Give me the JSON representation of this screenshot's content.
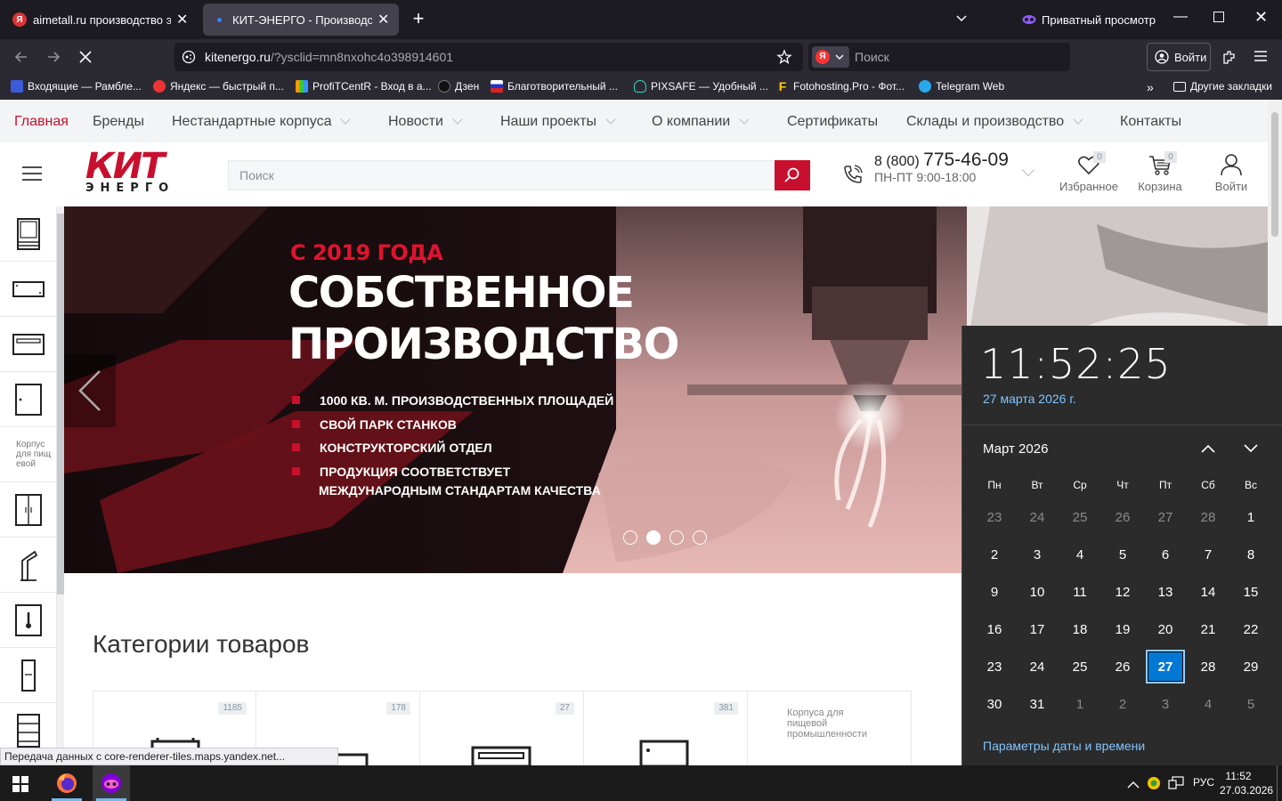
{
  "browser": {
    "tabs": [
      {
        "title": "aimetall.ru производство элект",
        "active": false
      },
      {
        "title": "КИТ-ЭНЕРГО - Производство э",
        "active": true
      }
    ],
    "private_label": "Приватный просмотр",
    "url_domain": "kitenergo.ru",
    "url_path": "/?ysclid=mn8nxohc4o398914601",
    "search_placeholder": "Поиск",
    "login_label": "Войти",
    "bookmarks": [
      "Входящие — Рамбле...",
      "Яндекс — быстрый п...",
      "ProfiTCentR - Вход в а...",
      "Дзен",
      "Благотворительный ...",
      "PIXSAFE — Удобный ...",
      "Fotohosting.Pro - Фот...",
      "Telegram Web"
    ],
    "other_bookmarks": "Другие закладки",
    "status_text": "Передача данных с core-renderer-tiles.maps.yandex.net..."
  },
  "site": {
    "topnav": [
      {
        "label": "Главная",
        "active": true,
        "chevron": false
      },
      {
        "label": "Бренды",
        "active": false,
        "chevron": false
      },
      {
        "label": "Нестандартные корпуса",
        "active": false,
        "chevron": true
      },
      {
        "label": "Новости",
        "active": false,
        "chevron": true
      },
      {
        "label": "Наши проекты",
        "active": false,
        "chevron": true
      },
      {
        "label": "О компании",
        "active": false,
        "chevron": true
      },
      {
        "label": "Сертификаты",
        "active": false,
        "chevron": false
      },
      {
        "label": "Склады и производство",
        "active": false,
        "chevron": true
      },
      {
        "label": "Контакты",
        "active": false,
        "chevron": false
      }
    ],
    "logo_top": "КИТ",
    "logo_bottom": "ЭНЕРГО",
    "search_placeholder": "Поиск",
    "phone_prefix": "8 (800) ",
    "phone_main": "775-46-09",
    "hours": "ПН-ПТ 9:00-18:00",
    "favorites_label": "Избранное",
    "favorites_count": "0",
    "cart_label": "Корзина",
    "cart_count": "0",
    "login_label": "Войти",
    "sidebar_text": "Корпус для пищевой",
    "banner": {
      "kicker": "С 2019 ГОДА",
      "title_line1": "СОБСТВЕННОЕ",
      "title_line2": "ПРОИЗВОДСТВО",
      "bullets": [
        "1000 КВ. М. ПРОИЗВОДСТВЕННЫХ ПЛОЩАДЕЙ",
        "СВОЙ ПАРК СТАНКОВ",
        "КОНСТРУКТОРСКИЙ ОТДЕЛ",
        "ПРОДУКЦИЯ СООТВЕТСТВУЕТ"
      ],
      "bullet_cont": "МЕЖДУНАРОДНЫМ СТАНДАРТАМ КАЧЕСТВА",
      "active_dot": 2
    },
    "categories_title": "Категории товаров",
    "category_counts": [
      "1185",
      "178",
      "27",
      "381"
    ],
    "category_text": "Корпуса для пищевой промышленности"
  },
  "calendar": {
    "time": "11:52:25",
    "date_long": "27 марта 2026 г.",
    "month": "Март 2026",
    "weekdays": [
      "Пн",
      "Вт",
      "Ср",
      "Чт",
      "Пт",
      "Сб",
      "Вс"
    ],
    "days": [
      [
        "23",
        "24",
        "25",
        "26",
        "27",
        "28",
        "1"
      ],
      [
        "2",
        "3",
        "4",
        "5",
        "6",
        "7",
        "8"
      ],
      [
        "9",
        "10",
        "11",
        "12",
        "13",
        "14",
        "15"
      ],
      [
        "16",
        "17",
        "18",
        "19",
        "20",
        "21",
        "22"
      ],
      [
        "23",
        "24",
        "25",
        "26",
        "27",
        "28",
        "29"
      ],
      [
        "30",
        "31",
        "1",
        "2",
        "3",
        "4",
        "5"
      ]
    ],
    "today": "27",
    "settings_link": "Параметры даты и времени"
  },
  "taskbar": {
    "lang": "РУС",
    "time": "11:52",
    "date": "27.03.2026"
  },
  "colors": {
    "brand_red": "#c8102e",
    "browser_dark": "#1c1b22",
    "calendar_today": "#0078d4"
  }
}
